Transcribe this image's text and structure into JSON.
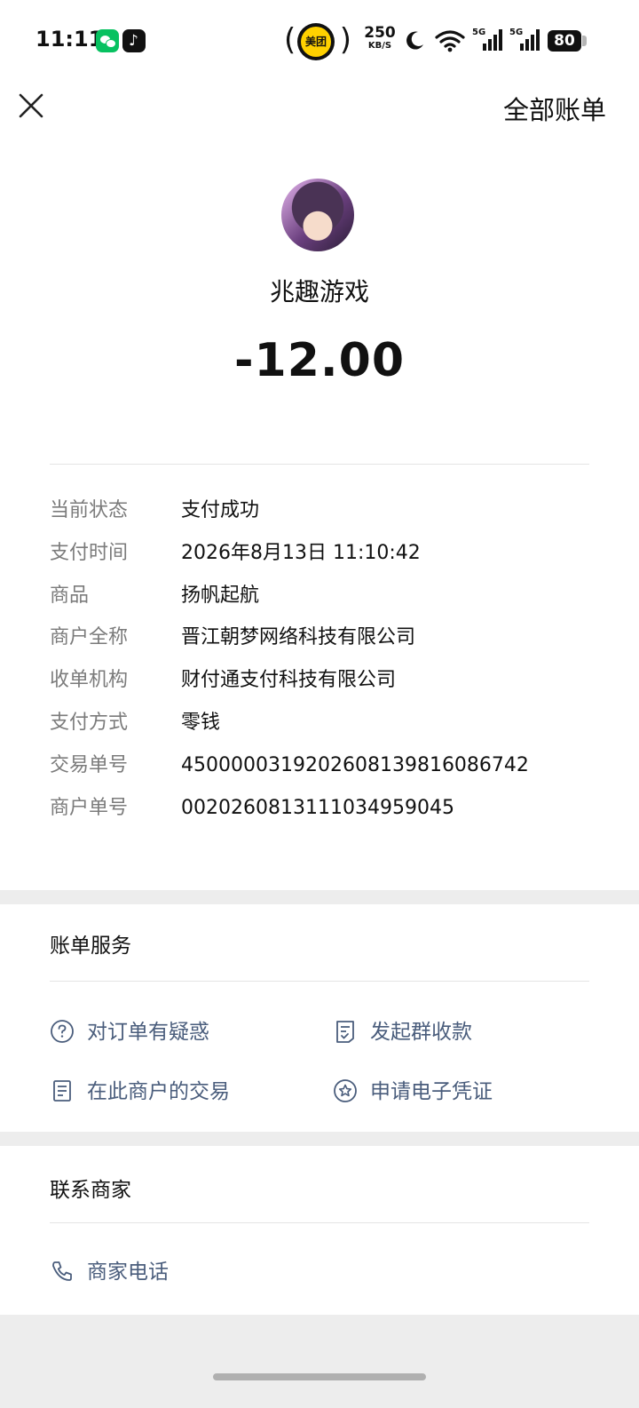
{
  "status_bar": {
    "time": "11:11",
    "meituan_label": "美团",
    "network_speed": "250",
    "network_speed_unit": "KB/S",
    "signal_1_tag": "5G",
    "signal_2_tag": "5G",
    "battery_level": "80",
    "app_icons": [
      "wechat-icon",
      "tiktok-icon"
    ]
  },
  "header": {
    "close_icon": "close-icon",
    "all_bills_label": "全部账单"
  },
  "transaction": {
    "merchant_name": "兆趣游戏",
    "amount": "-12.00",
    "details": [
      {
        "label": "当前状态",
        "value": "支付成功"
      },
      {
        "label": "支付时间",
        "value": "2026年8月13日 11:10:42"
      },
      {
        "label": "商品",
        "value": "扬帆起航"
      },
      {
        "label": "商户全称",
        "value": "晋江朝梦网络科技有限公司"
      },
      {
        "label": "收单机构",
        "value": "财付通支付科技有限公司"
      },
      {
        "label": "支付方式",
        "value": "零钱"
      },
      {
        "label": "交易单号",
        "value": "4500000319202608139816086742"
      },
      {
        "label": "商户单号",
        "value": "00202608131110349590​45"
      }
    ]
  },
  "bill_services": {
    "title": "账单服务",
    "items": [
      {
        "label": "对订单有疑惑",
        "icon": "question-circle-icon"
      },
      {
        "label": "发起群收款",
        "icon": "document-check-icon"
      },
      {
        "label": "在此商户的交易",
        "icon": "document-list-icon"
      },
      {
        "label": "申请电子凭证",
        "icon": "star-badge-icon"
      }
    ]
  },
  "contact_merchant": {
    "title": "联系商家",
    "phone_label": "商家电话",
    "phone_icon": "phone-icon"
  },
  "colors": {
    "link_text": "#4a5d7c",
    "label_text": "#7b7b7b",
    "page_background": "#ededed"
  }
}
